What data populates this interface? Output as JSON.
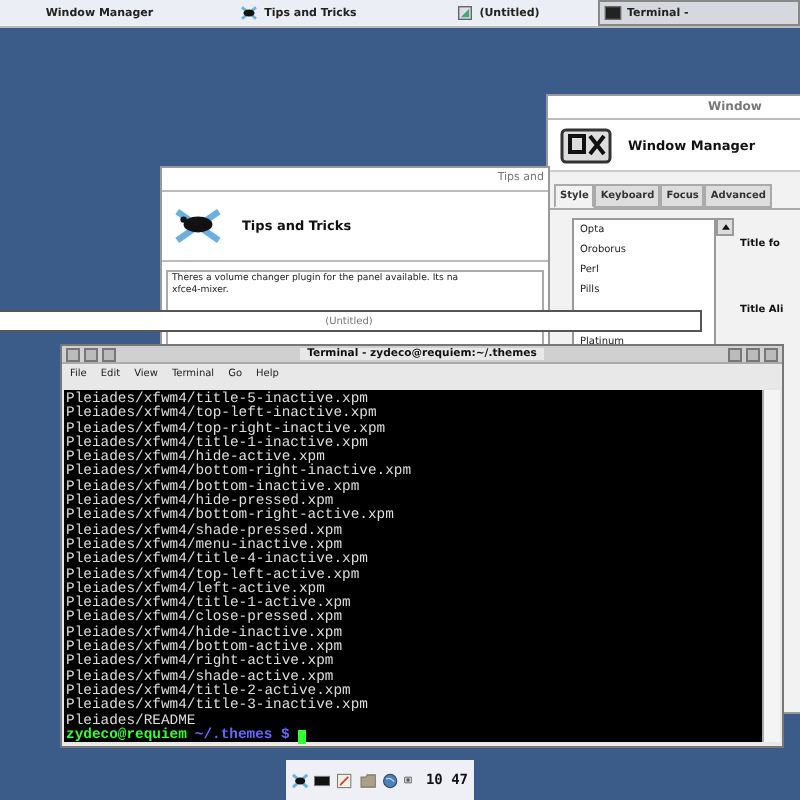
{
  "taskbar": {
    "items": [
      {
        "label": "Window Manager",
        "kind": "none",
        "selected": false
      },
      {
        "label": "Tips and Tricks",
        "kind": "mouse",
        "selected": false
      },
      {
        "label": "(Untitled)",
        "kind": "image",
        "selected": false
      },
      {
        "label": "Terminal -",
        "kind": "terminal",
        "selected": true
      }
    ]
  },
  "window_manager": {
    "title": "Window",
    "heading": "Window Manager",
    "tabs": [
      {
        "label": "Style",
        "selected": true
      },
      {
        "label": "Keyboard",
        "selected": false
      },
      {
        "label": "Focus",
        "selected": false
      },
      {
        "label": "Advanced",
        "selected": false
      }
    ],
    "themes": [
      "Opta",
      "Oroborus",
      "Perl",
      "Pills",
      "Platinum"
    ],
    "labels": [
      "Title fo",
      "Title Ali"
    ]
  },
  "tips": {
    "title": "Tips and",
    "heading": "Tips and Tricks",
    "text": "Theres a volume changer plugin for the panel available. Its na\nxfce4-mixer."
  },
  "untitled": {
    "title": "(Untitled)"
  },
  "terminal": {
    "title": "Terminal - zydeco@requiem:~/.themes",
    "menu": [
      "File",
      "Edit",
      "View",
      "Terminal",
      "Go",
      "Help"
    ],
    "lines": [
      "Pleiades/xfwm4/title-5-inactive.xpm",
      "Pleiades/xfwm4/top-left-inactive.xpm",
      "Pleiades/xfwm4/top-right-inactive.xpm",
      "Pleiades/xfwm4/title-1-inactive.xpm",
      "Pleiades/xfwm4/hide-active.xpm",
      "Pleiades/xfwm4/bottom-right-inactive.xpm",
      "Pleiades/xfwm4/bottom-inactive.xpm",
      "Pleiades/xfwm4/hide-pressed.xpm",
      "Pleiades/xfwm4/bottom-right-active.xpm",
      "Pleiades/xfwm4/shade-pressed.xpm",
      "Pleiades/xfwm4/menu-inactive.xpm",
      "Pleiades/xfwm4/title-4-inactive.xpm",
      "Pleiades/xfwm4/top-left-active.xpm",
      "Pleiades/xfwm4/left-active.xpm",
      "Pleiades/xfwm4/title-1-active.xpm",
      "Pleiades/xfwm4/close-pressed.xpm",
      "Pleiades/xfwm4/hide-inactive.xpm",
      "Pleiades/xfwm4/bottom-active.xpm",
      "Pleiades/xfwm4/right-active.xpm",
      "Pleiades/xfwm4/shade-active.xpm",
      "Pleiades/xfwm4/title-2-active.xpm",
      "Pleiades/xfwm4/title-3-inactive.xpm",
      "Pleiades/README"
    ],
    "prompt": {
      "user": "zydeco@requiem",
      "path": "~/.themes",
      "symbol": "$"
    }
  },
  "panel": {
    "clock": "10 47"
  }
}
